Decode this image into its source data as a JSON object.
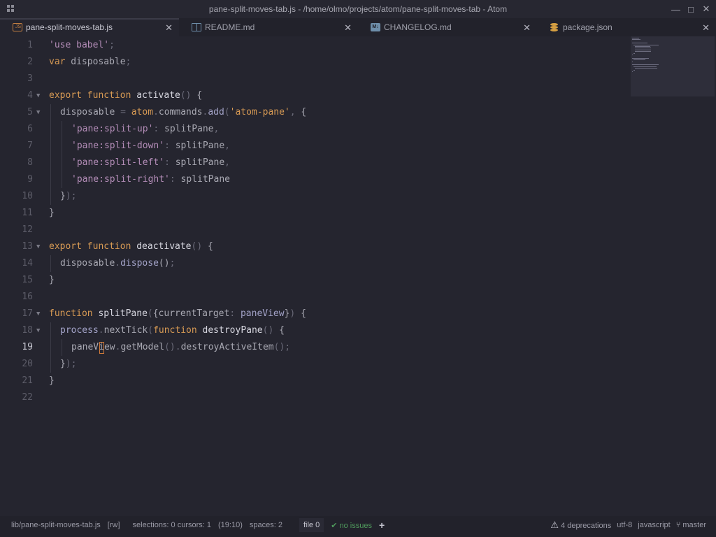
{
  "window": {
    "title": "pane-split-moves-tab.js - /home/olmo/projects/atom/pane-split-moves-tab - Atom",
    "controls": [
      "—",
      "□",
      "✕"
    ]
  },
  "tabs": [
    {
      "label": "pane-split-moves-tab.js",
      "icon": "js-file-icon",
      "active": true
    },
    {
      "label": "README.md",
      "icon": "book-icon",
      "active": false
    },
    {
      "label": "CHANGELOG.md",
      "icon": "markdown-icon",
      "active": false
    },
    {
      "label": "package.json",
      "icon": "database-icon",
      "active": false
    }
  ],
  "editor": {
    "cursor_line": 19,
    "lines": [
      {
        "n": "1",
        "fold": false,
        "indent": 0,
        "html": "<span class=\"str\">'use babel'</span><span class=\"punc\">;</span>"
      },
      {
        "n": "2",
        "fold": false,
        "indent": 0,
        "html": "<span class=\"kw\">var</span> disposable<span class=\"punc\">;</span>"
      },
      {
        "n": "3",
        "fold": false,
        "indent": 0,
        "html": ""
      },
      {
        "n": "4",
        "fold": true,
        "indent": 0,
        "html": "<span class=\"kw\">export function</span> <span class=\"fn\">activate</span><span class=\"punc\">()</span> {"
      },
      {
        "n": "5",
        "fold": true,
        "indent": 1,
        "html": "disposable <span class=\"punc\">=</span> <span class=\"kw\">atom</span><span class=\"punc\">.</span>commands<span class=\"punc\">.</span><span class=\"prop\">add</span><span class=\"punc\">(</span><span class=\"kw\">'atom-pane'</span><span class=\"punc\">,</span> {"
      },
      {
        "n": "6",
        "fold": false,
        "indent": 2,
        "html": "<span class=\"str\">'pane:split-up'</span><span class=\"punc\">:</span> splitPane<span class=\"punc\">,</span>"
      },
      {
        "n": "7",
        "fold": false,
        "indent": 2,
        "html": "<span class=\"str\">'pane:split-down'</span><span class=\"punc\">:</span> splitPane<span class=\"punc\">,</span>"
      },
      {
        "n": "8",
        "fold": false,
        "indent": 2,
        "html": "<span class=\"str\">'pane:split-left'</span><span class=\"punc\">:</span> splitPane<span class=\"punc\">,</span>"
      },
      {
        "n": "9",
        "fold": false,
        "indent": 2,
        "html": "<span class=\"str\">'pane:split-right'</span><span class=\"punc\">:</span> splitPane"
      },
      {
        "n": "10",
        "fold": false,
        "indent": 1,
        "html": "}<span class=\"punc\">);</span>"
      },
      {
        "n": "11",
        "fold": false,
        "indent": 0,
        "html": "}"
      },
      {
        "n": "12",
        "fold": false,
        "indent": 0,
        "html": ""
      },
      {
        "n": "13",
        "fold": true,
        "indent": 0,
        "html": "<span class=\"kw\">export function</span> <span class=\"fn\">deactivate</span><span class=\"punc\">()</span> {"
      },
      {
        "n": "14",
        "fold": false,
        "indent": 1,
        "html": "disposable<span class=\"punc\">.</span><span class=\"prop\">dispose</span>()<span class=\"punc\">;</span>"
      },
      {
        "n": "15",
        "fold": false,
        "indent": 0,
        "html": "}"
      },
      {
        "n": "16",
        "fold": false,
        "indent": 0,
        "html": ""
      },
      {
        "n": "17",
        "fold": true,
        "indent": 0,
        "html": "<span class=\"kw\">function</span> <span class=\"fn\">splitPane</span><span class=\"punc\">(</span>{currentTarget<span class=\"punc\">:</span> <span class=\"prop\">paneView</span>}<span class=\"punc\">)</span> {"
      },
      {
        "n": "18",
        "fold": true,
        "indent": 1,
        "html": "<span class=\"prop\">process</span><span class=\"punc\">.</span>nextTick<span class=\"punc\">(</span><span class=\"kw\">function</span> <span class=\"fn\">destroyPane</span><span class=\"punc\">()</span> {"
      },
      {
        "n": "19",
        "fold": false,
        "indent": 2,
        "html": "paneView<span class=\"punc\">.</span>getModel<span class=\"punc\">().</span>destroyActiveItem<span class=\"punc\">();</span>"
      },
      {
        "n": "20",
        "fold": false,
        "indent": 1,
        "html": "}<span class=\"punc\">);</span>"
      },
      {
        "n": "21",
        "fold": false,
        "indent": 0,
        "html": "}"
      },
      {
        "n": "22",
        "fold": false,
        "indent": 0,
        "html": ""
      }
    ]
  },
  "status": {
    "path": "lib/pane-split-moves-tab.js",
    "mode": "[rw]",
    "selections": "selections: 0 cursors: 1",
    "position": "(19:10)",
    "spaces": "spaces: 2",
    "file_count": "file 0",
    "linter": "no issues",
    "deprecations": "4 deprecations",
    "encoding": "utf-8",
    "grammar": "javascript",
    "branch": "master"
  },
  "colors": {
    "background": "#25252f",
    "keyword": "#d79a54",
    "string": "#b48db8",
    "ok": "#4f9a5c"
  }
}
